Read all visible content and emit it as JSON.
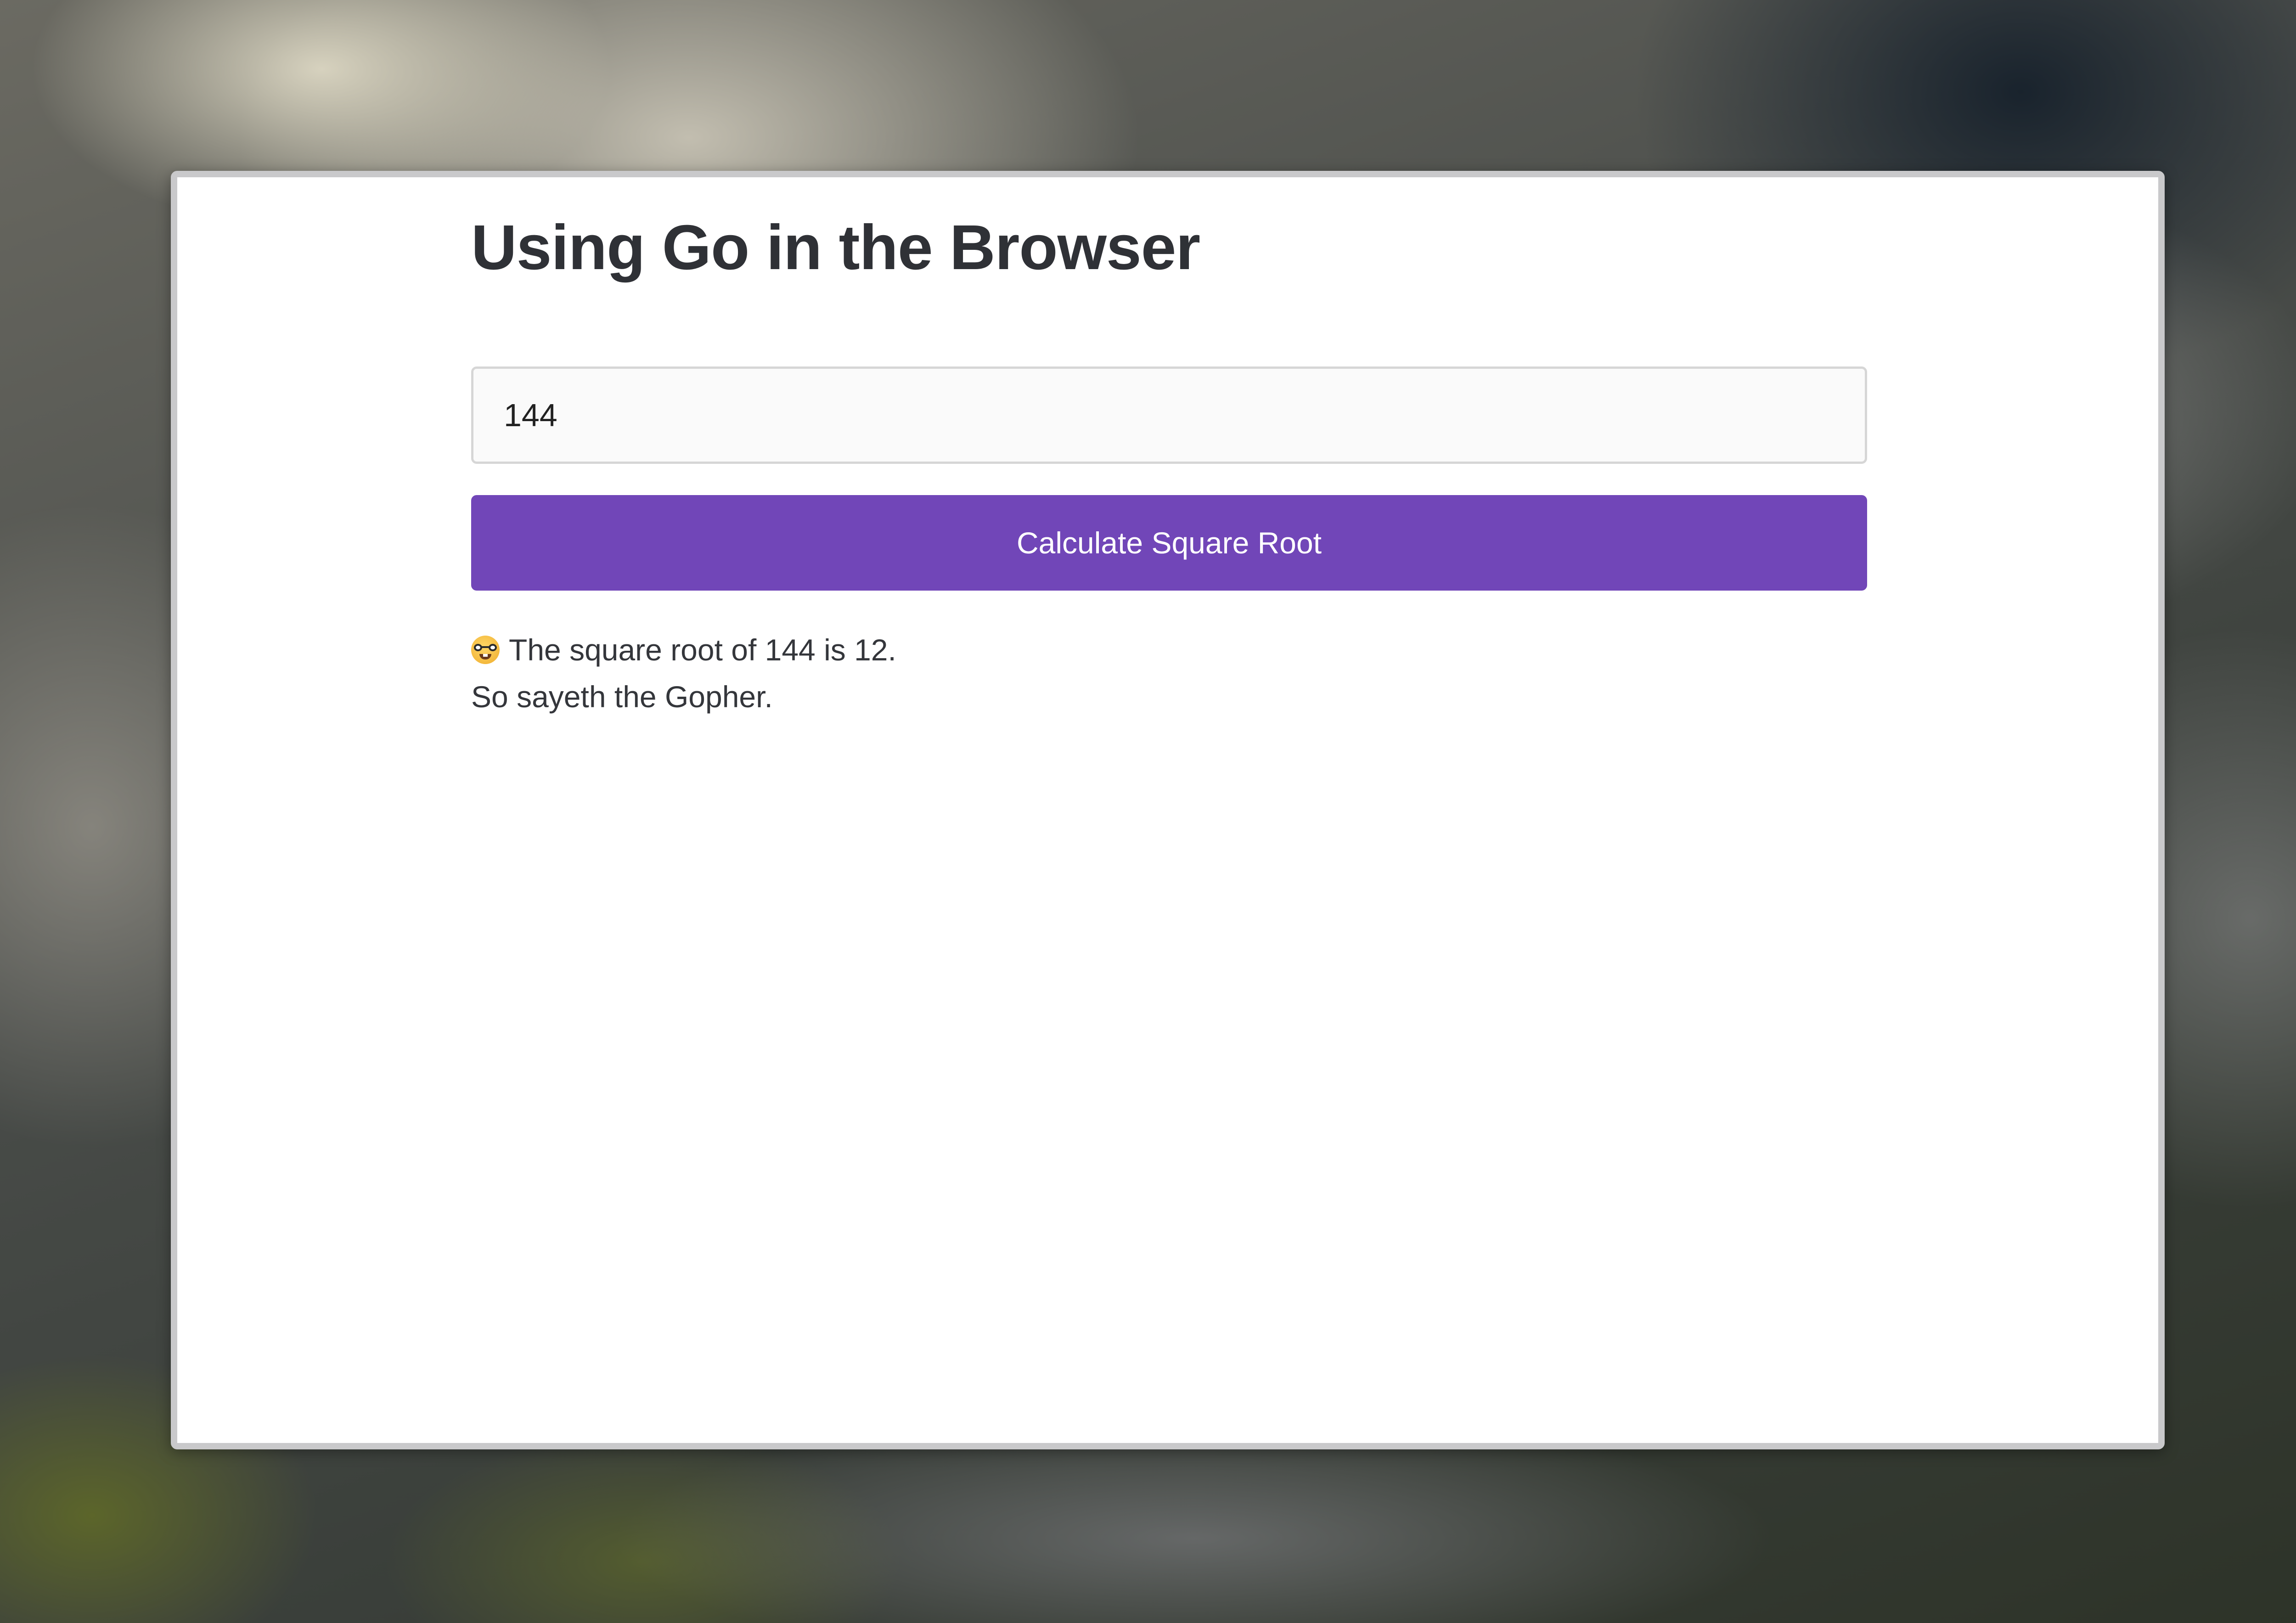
{
  "page": {
    "title": "Using Go in the Browser"
  },
  "input": {
    "value": "144"
  },
  "button": {
    "label": "Calculate Square Root"
  },
  "result": {
    "icon": "nerd-face-icon",
    "line1": "The square root of 144 is 12.",
    "line2": "So sayeth the Gopher."
  },
  "colors": {
    "accent": "#7146b8",
    "title": "#2f3136",
    "text": "#34363b"
  }
}
